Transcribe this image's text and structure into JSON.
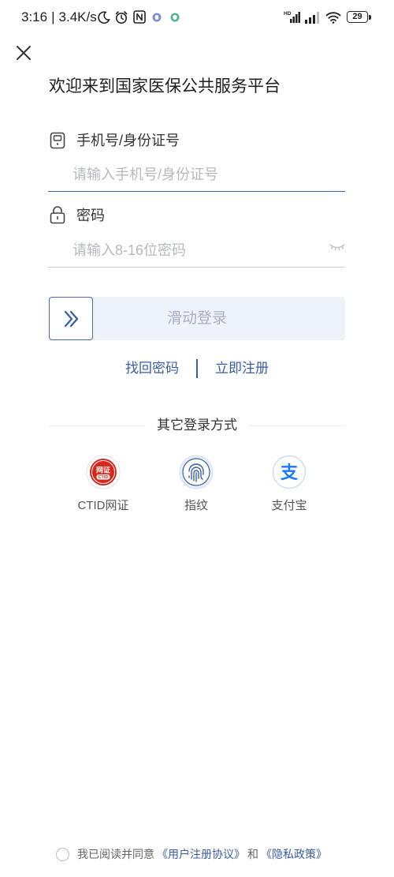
{
  "status_bar": {
    "time": "3:16",
    "separator": "|",
    "net_speed": "3.4K/s",
    "hd": "HD",
    "battery": "29",
    "icons": [
      "moon-icon",
      "alarm-icon",
      "nfc-icon",
      "app-notification-icon",
      "shield-notification-icon",
      "hd-signal-icon",
      "signal-icon",
      "wifi-icon",
      "battery-icon"
    ]
  },
  "header": {
    "close_icon": "close-icon",
    "title": "欢迎来到国家医保公共服务平台"
  },
  "form": {
    "account": {
      "icon": "phone-icon",
      "label": "手机号/身份证号",
      "placeholder": "请输入手机号/身份证号",
      "value": ""
    },
    "password": {
      "icon": "lock-icon",
      "label": "密码",
      "placeholder": "请输入8-16位密码",
      "value": "",
      "toggle_icon": "eye-closed-icon"
    },
    "slider": {
      "label": "滑动登录",
      "handle_icon": "double-chevron-right-icon",
      "progress": 0
    },
    "links": {
      "forgot": "找回密码",
      "register": "立即注册"
    }
  },
  "other_login": {
    "title": "其它登录方式",
    "methods": [
      {
        "label": "CTID网证",
        "icon": "ctid-icon",
        "logo_text": "网证",
        "logo_sub": "CTID"
      },
      {
        "label": "指纹",
        "icon": "fingerprint-icon"
      },
      {
        "label": "支付宝",
        "icon": "alipay-icon",
        "logo_glyph": "支"
      }
    ]
  },
  "agreement": {
    "checked": false,
    "prefix": "我已阅读并同意",
    "user_agreement": "《用户注册协议》",
    "conjunction": "和",
    "privacy_policy": "《隐私政策》"
  },
  "colors": {
    "accent": "#3d62a8",
    "link": "#3a5da5",
    "placeholder": "#b5b9c1",
    "slider_bg": "#eef2f9",
    "ctid_red": "#d8261b",
    "alipay_blue": "#1677ff"
  }
}
